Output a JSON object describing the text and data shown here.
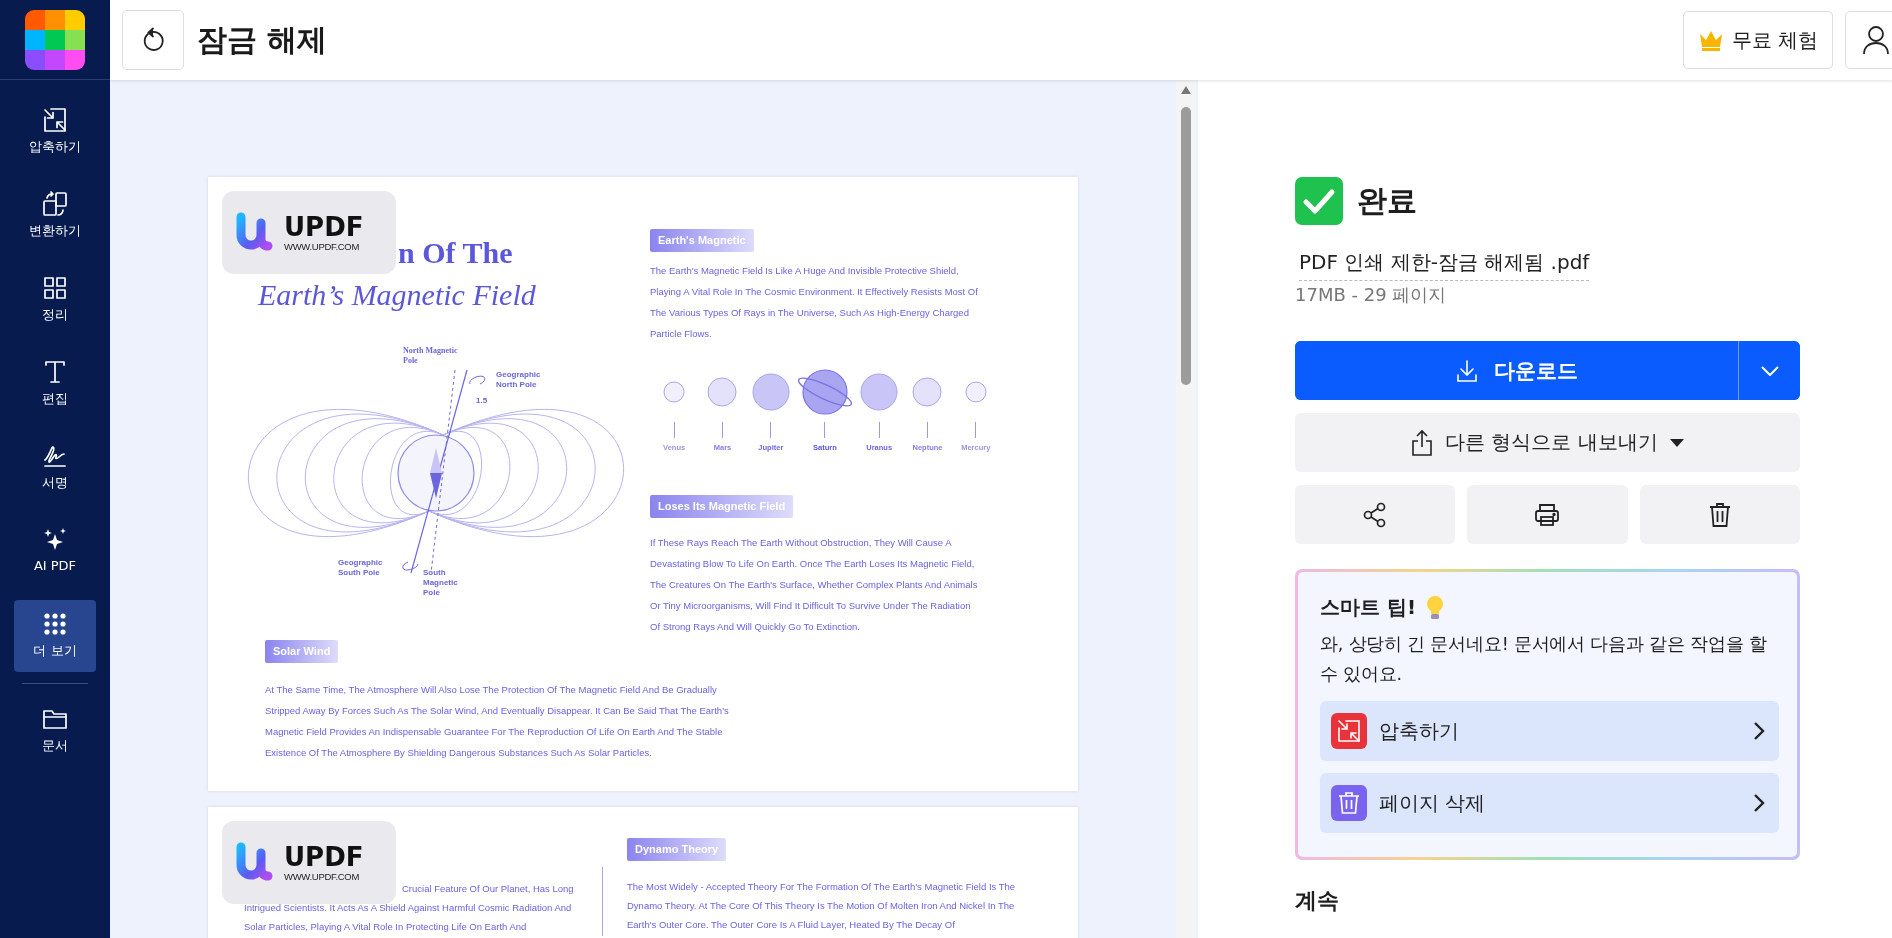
{
  "sidebar": {
    "items": [
      {
        "label": "압축하기",
        "selected": false
      },
      {
        "label": "변환하기",
        "selected": false
      },
      {
        "label": "정리",
        "selected": false
      },
      {
        "label": "편집",
        "selected": false
      },
      {
        "label": "서명",
        "selected": false
      },
      {
        "label": "AI PDF",
        "selected": false
      },
      {
        "label": "더 보기",
        "selected": true
      },
      {
        "label": "문서",
        "selected": false
      }
    ]
  },
  "header": {
    "title": "잠금 해제",
    "trial_button": "무료 체험"
  },
  "document": {
    "page_1": {
      "watermark": {
        "brand": "UPDF",
        "url": "WWW.UPDF.COM"
      },
      "title_line_1": "n Of The",
      "title_line_2": "Earth’s Magnetic Field",
      "diagram_labels": {
        "north_magnetic_pole": "North Magnetic Pole",
        "geographic_north_pole": "Geographic North Pole",
        "angle": "1.5",
        "geographic_south_pole": "Geographic South Pole",
        "south_magnetic_pole": "South Magnetic Pole"
      },
      "sections": [
        {
          "heading": "Earth's Magnetic",
          "text": "The Earth's Magnetic Field Is Like A Huge And Invisible Protective Shield, Playing A Vital Role In The Cosmic Environment. It Effectively Resists Most Of The Various Types Of Rays in The Universe, Such As High-Energy Charged Particle Flows."
        },
        {
          "heading": "Loses Its Magnetic Field",
          "text": "If These Rays Reach The Earth Without Obstruction, They Will Cause A Devastating Blow To Life On Earth. Once The Earth Loses Its Magnetic Field, The Creatures On The Earth's Surface, Whether Complex Plants And Animals Or Tiny Microorganisms, Will Find It Difficult To Survive Under The Radiation Of Strong Rays And Will Quickly Go To Extinction."
        },
        {
          "heading": "Solar Wind",
          "text": "At The Same Time, The Atmosphere Will Also Lose The Protection Of The Magnetic Field And Be Gradually Stripped Away By Forces Such As The Solar Wind, And Eventually Disappear. It Can Be Said That The Earth's Magnetic Field Provides An Indispensable Guarantee For The Reproduction Of Life On Earth And The Stable Existence Of The Atmosphere By Shielding Dangerous Substances Such As Solar Particles."
        }
      ],
      "planets": [
        {
          "name": "Venus",
          "kind": "plain"
        },
        {
          "name": "Mars",
          "kind": "plain"
        },
        {
          "name": "Jupiter",
          "kind": "plain"
        },
        {
          "name": "Saturn",
          "kind": "ringed"
        },
        {
          "name": "Uranus",
          "kind": "plain"
        },
        {
          "name": "Neptune",
          "kind": "plain"
        },
        {
          "name": "Mercury",
          "kind": "plain"
        }
      ]
    },
    "page_2": {
      "watermark": {
        "brand": "UPDF",
        "url": "WWW.UPDF.COM"
      },
      "left_text": "Crucial Feature Of Our Planet, Has Long Intrigued Scientists. It Acts As A Shield Against Harmful Cosmic Radiation And Solar Particles, Playing A Vital Role In Protecting Life On Earth And",
      "sections": [
        {
          "heading": "Dynamo Theory",
          "text": "The Most Widely - Accepted Theory For The Formation Of The Earth's Magnetic Field Is The Dynamo Theory. At The Core Of This Theory Is The Motion Of Molten Iron And Nickel In The Earth's Outer Core. The Outer Core Is A Fluid Layer, Heated By The Decay Of"
        }
      ]
    }
  },
  "result": {
    "status": "완료",
    "file_name": "PDF 인쇄 제한-잠금 해제됨 .pdf",
    "file_meta": "17MB - 29 페이지",
    "download_button": "다운로드",
    "export_button": "다른 형식으로 내보내기",
    "smart_tip": {
      "title": "스마트 팁!",
      "text": "와, 상당히 긴 문서네요! 문서에서 다음과 같은 작업을 할 수 있어요.",
      "actions": [
        {
          "label": "압축하기",
          "color": "#e8333a"
        },
        {
          "label": "페이지 삭제",
          "color": "#7a63ee"
        }
      ]
    },
    "continue_heading": "계속"
  }
}
